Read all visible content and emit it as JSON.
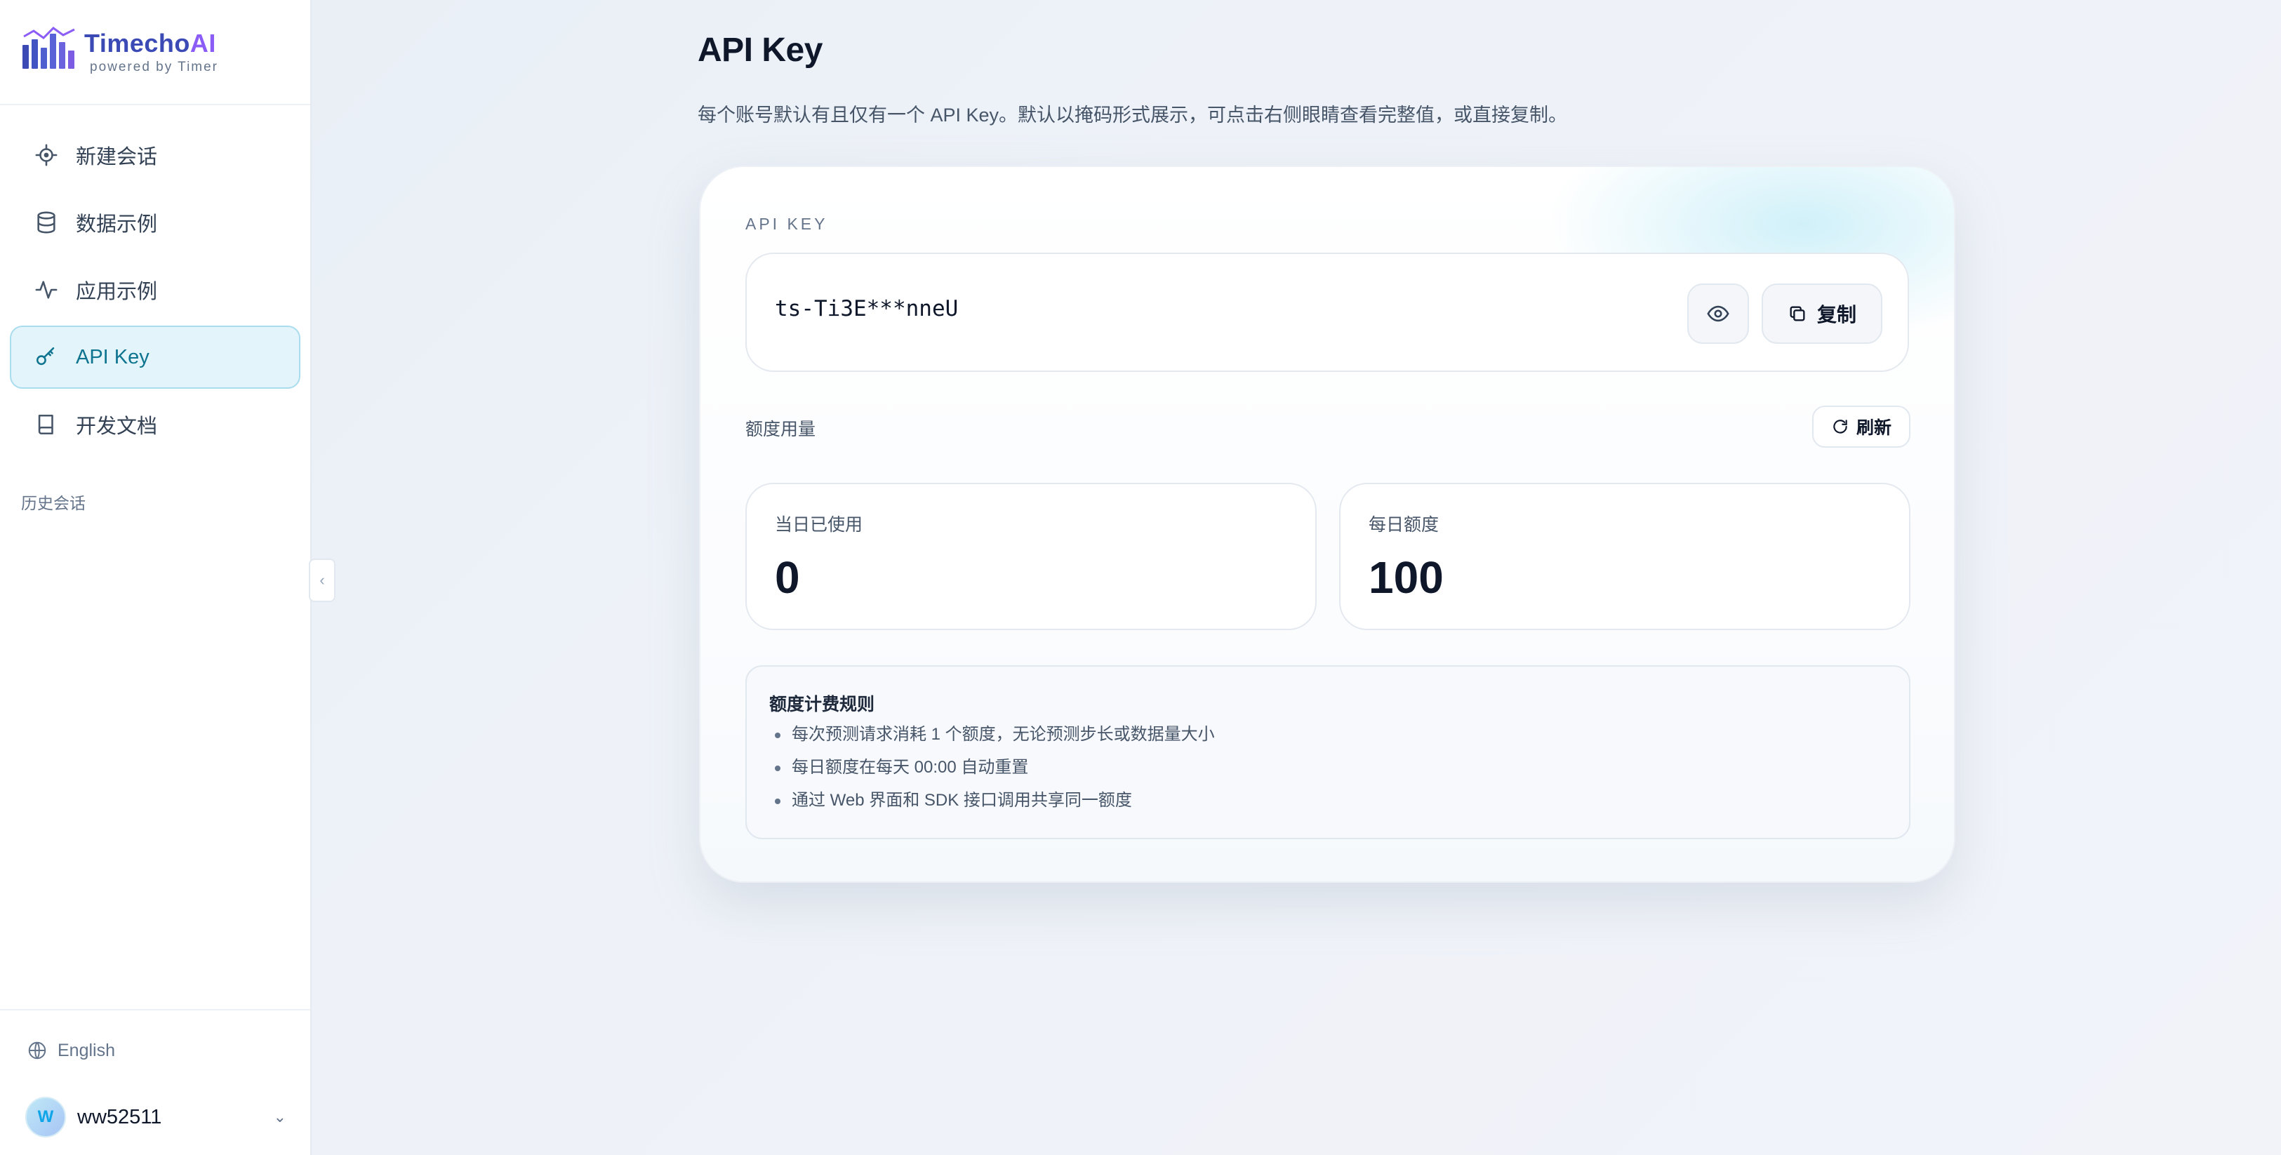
{
  "brand": {
    "name_main": "Timecho",
    "name_accent": "AI",
    "subtitle": "powered by Timer"
  },
  "sidebar": {
    "items": [
      {
        "label": "新建会话",
        "icon": "crosshair-icon"
      },
      {
        "label": "数据示例",
        "icon": "database-icon"
      },
      {
        "label": "应用示例",
        "icon": "activity-icon"
      },
      {
        "label": "API Key",
        "icon": "key-icon",
        "active": true
      },
      {
        "label": "开发文档",
        "icon": "book-icon"
      }
    ],
    "history_label": "历史会话",
    "language": "English",
    "user": {
      "initial": "W",
      "name": "ww52511"
    }
  },
  "main": {
    "title": "API Key",
    "description": "每个账号默认有且仅有一个 API Key。默认以掩码形式展示，可点击右侧眼睛查看完整值，或直接复制。",
    "apikey": {
      "label": "API KEY",
      "value": "ts-Ti3E***nneU",
      "copy_label": "复制"
    },
    "quota": {
      "label": "额度用量",
      "refresh_label": "刷新",
      "used_label": "当日已使用",
      "used_value": "0",
      "daily_label": "每日额度",
      "daily_value": "100"
    },
    "rules": {
      "title": "额度计费规则",
      "items": [
        "每次预测请求消耗 1 个额度，无论预测步长或数据量大小",
        "每日额度在每天 00:00 自动重置",
        "通过 Web 界面和 SDK 接口调用共享同一额度"
      ]
    }
  },
  "colors": {
    "accent": "#0e7490",
    "active_bg": "#e3f4fa",
    "brand": "#3b4ab4",
    "brand_accent": "#8b5cf6"
  }
}
